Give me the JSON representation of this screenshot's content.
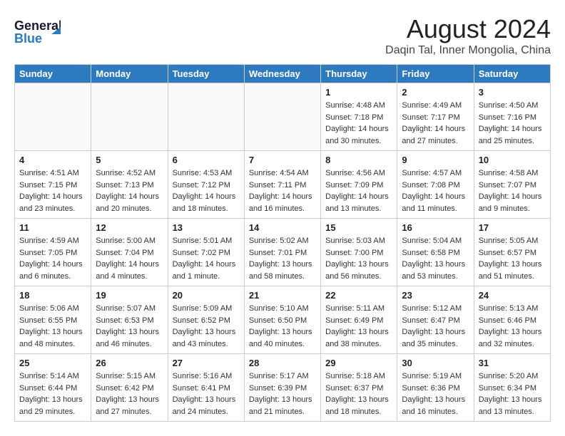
{
  "header": {
    "logo_line1": "General",
    "logo_line2": "Blue",
    "month_title": "August 2024",
    "location": "Daqin Tal, Inner Mongolia, China"
  },
  "weekdays": [
    "Sunday",
    "Monday",
    "Tuesday",
    "Wednesday",
    "Thursday",
    "Friday",
    "Saturday"
  ],
  "weeks": [
    [
      {
        "date": "",
        "info": ""
      },
      {
        "date": "",
        "info": ""
      },
      {
        "date": "",
        "info": ""
      },
      {
        "date": "",
        "info": ""
      },
      {
        "date": "1",
        "info": "Sunrise: 4:48 AM\nSunset: 7:18 PM\nDaylight: 14 hours\nand 30 minutes."
      },
      {
        "date": "2",
        "info": "Sunrise: 4:49 AM\nSunset: 7:17 PM\nDaylight: 14 hours\nand 27 minutes."
      },
      {
        "date": "3",
        "info": "Sunrise: 4:50 AM\nSunset: 7:16 PM\nDaylight: 14 hours\nand 25 minutes."
      }
    ],
    [
      {
        "date": "4",
        "info": "Sunrise: 4:51 AM\nSunset: 7:15 PM\nDaylight: 14 hours\nand 23 minutes."
      },
      {
        "date": "5",
        "info": "Sunrise: 4:52 AM\nSunset: 7:13 PM\nDaylight: 14 hours\nand 20 minutes."
      },
      {
        "date": "6",
        "info": "Sunrise: 4:53 AM\nSunset: 7:12 PM\nDaylight: 14 hours\nand 18 minutes."
      },
      {
        "date": "7",
        "info": "Sunrise: 4:54 AM\nSunset: 7:11 PM\nDaylight: 14 hours\nand 16 minutes."
      },
      {
        "date": "8",
        "info": "Sunrise: 4:56 AM\nSunset: 7:09 PM\nDaylight: 14 hours\nand 13 minutes."
      },
      {
        "date": "9",
        "info": "Sunrise: 4:57 AM\nSunset: 7:08 PM\nDaylight: 14 hours\nand 11 minutes."
      },
      {
        "date": "10",
        "info": "Sunrise: 4:58 AM\nSunset: 7:07 PM\nDaylight: 14 hours\nand 9 minutes."
      }
    ],
    [
      {
        "date": "11",
        "info": "Sunrise: 4:59 AM\nSunset: 7:05 PM\nDaylight: 14 hours\nand 6 minutes."
      },
      {
        "date": "12",
        "info": "Sunrise: 5:00 AM\nSunset: 7:04 PM\nDaylight: 14 hours\nand 4 minutes."
      },
      {
        "date": "13",
        "info": "Sunrise: 5:01 AM\nSunset: 7:02 PM\nDaylight: 14 hours\nand 1 minute."
      },
      {
        "date": "14",
        "info": "Sunrise: 5:02 AM\nSunset: 7:01 PM\nDaylight: 13 hours\nand 58 minutes."
      },
      {
        "date": "15",
        "info": "Sunrise: 5:03 AM\nSunset: 7:00 PM\nDaylight: 13 hours\nand 56 minutes."
      },
      {
        "date": "16",
        "info": "Sunrise: 5:04 AM\nSunset: 6:58 PM\nDaylight: 13 hours\nand 53 minutes."
      },
      {
        "date": "17",
        "info": "Sunrise: 5:05 AM\nSunset: 6:57 PM\nDaylight: 13 hours\nand 51 minutes."
      }
    ],
    [
      {
        "date": "18",
        "info": "Sunrise: 5:06 AM\nSunset: 6:55 PM\nDaylight: 13 hours\nand 48 minutes."
      },
      {
        "date": "19",
        "info": "Sunrise: 5:07 AM\nSunset: 6:53 PM\nDaylight: 13 hours\nand 46 minutes."
      },
      {
        "date": "20",
        "info": "Sunrise: 5:09 AM\nSunset: 6:52 PM\nDaylight: 13 hours\nand 43 minutes."
      },
      {
        "date": "21",
        "info": "Sunrise: 5:10 AM\nSunset: 6:50 PM\nDaylight: 13 hours\nand 40 minutes."
      },
      {
        "date": "22",
        "info": "Sunrise: 5:11 AM\nSunset: 6:49 PM\nDaylight: 13 hours\nand 38 minutes."
      },
      {
        "date": "23",
        "info": "Sunrise: 5:12 AM\nSunset: 6:47 PM\nDaylight: 13 hours\nand 35 minutes."
      },
      {
        "date": "24",
        "info": "Sunrise: 5:13 AM\nSunset: 6:46 PM\nDaylight: 13 hours\nand 32 minutes."
      }
    ],
    [
      {
        "date": "25",
        "info": "Sunrise: 5:14 AM\nSunset: 6:44 PM\nDaylight: 13 hours\nand 29 minutes."
      },
      {
        "date": "26",
        "info": "Sunrise: 5:15 AM\nSunset: 6:42 PM\nDaylight: 13 hours\nand 27 minutes."
      },
      {
        "date": "27",
        "info": "Sunrise: 5:16 AM\nSunset: 6:41 PM\nDaylight: 13 hours\nand 24 minutes."
      },
      {
        "date": "28",
        "info": "Sunrise: 5:17 AM\nSunset: 6:39 PM\nDaylight: 13 hours\nand 21 minutes."
      },
      {
        "date": "29",
        "info": "Sunrise: 5:18 AM\nSunset: 6:37 PM\nDaylight: 13 hours\nand 18 minutes."
      },
      {
        "date": "30",
        "info": "Sunrise: 5:19 AM\nSunset: 6:36 PM\nDaylight: 13 hours\nand 16 minutes."
      },
      {
        "date": "31",
        "info": "Sunrise: 5:20 AM\nSunset: 6:34 PM\nDaylight: 13 hours\nand 13 minutes."
      }
    ]
  ]
}
